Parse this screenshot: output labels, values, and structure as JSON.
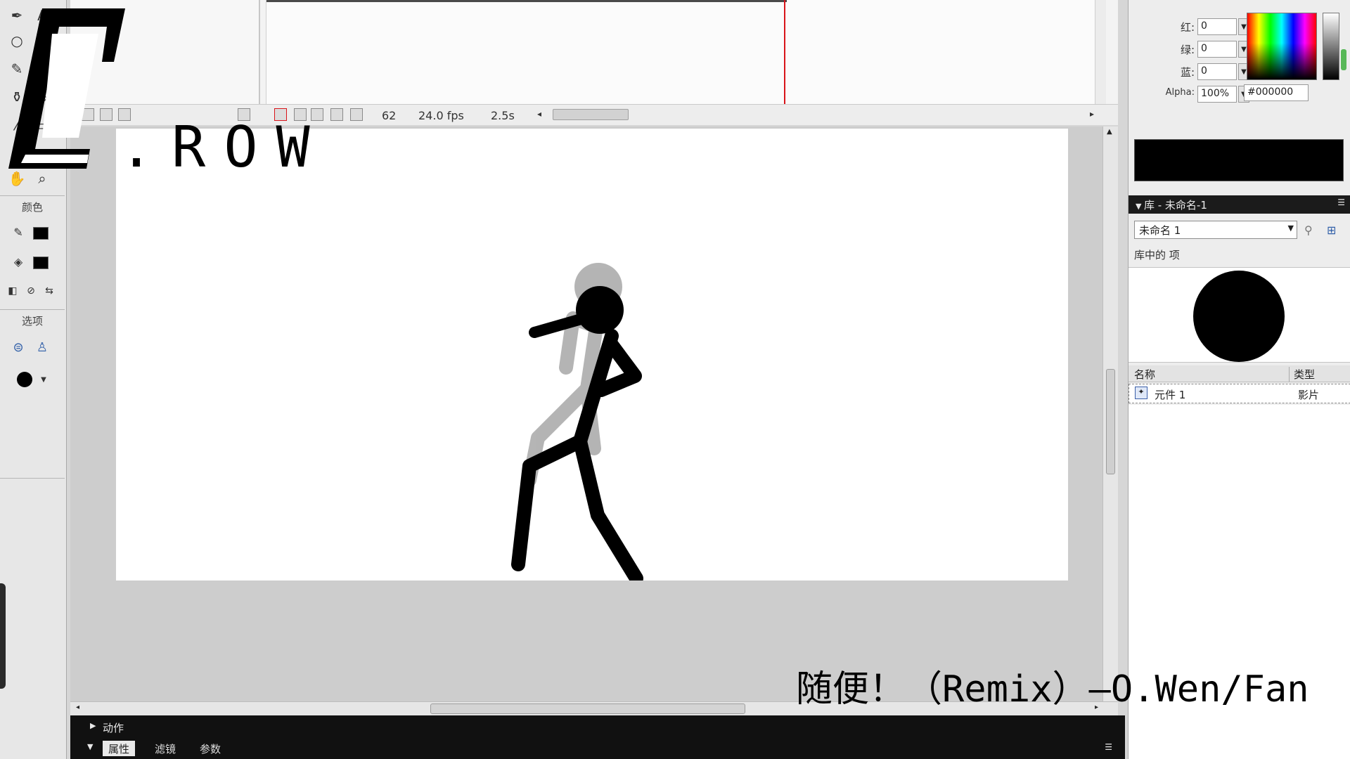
{
  "timeline": {
    "frame_number": "62",
    "frame_rate": "24.0 fps",
    "elapsed_time": "2.5s"
  },
  "tools": {
    "color_section_label": "颜色",
    "options_section_label": "选项"
  },
  "color_mixer": {
    "red_label": "红:",
    "red_value": "0",
    "green_label": "绿:",
    "green_value": "0",
    "blue_label": "蓝:",
    "blue_value": "0",
    "alpha_label": "Alpha:",
    "alpha_value": "100%",
    "hex_value": "#000000",
    "selected_color": "#000000"
  },
  "library": {
    "header_title": "库 - 未命名-1",
    "document_select": "未命名 1",
    "item_count_label": "库中的   项",
    "col_name": "名称",
    "col_type": "类型",
    "item_name": "元件 1",
    "item_type": "影片"
  },
  "bottom_panels": {
    "actions_label": "动作",
    "tabs": [
      "属性",
      "滤镜",
      "参数"
    ]
  },
  "overlay": {
    "channel_brand": ".ROW",
    "song_caption": "随便！（Remix）—O.Wen/Fan"
  },
  "colors": {
    "playhead": "#d9141a",
    "stage": "#ffffff",
    "pasteboard": "#cdcdcd"
  }
}
